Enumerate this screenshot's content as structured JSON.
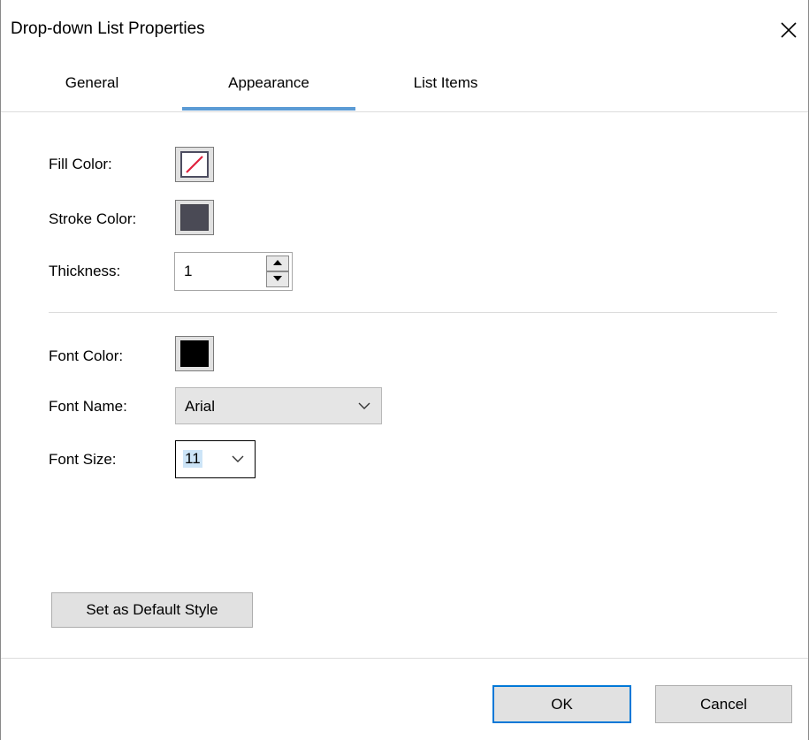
{
  "window": {
    "title": "Drop-down List Properties",
    "close_icon": "close-icon"
  },
  "tabs": [
    {
      "label": "General",
      "active": false
    },
    {
      "label": "Appearance",
      "active": true
    },
    {
      "label": "List Items",
      "active": false
    }
  ],
  "appearance": {
    "fill_color": {
      "label": "Fill Color:",
      "value": "none"
    },
    "stroke_color": {
      "label": "Stroke Color:",
      "value": "#4a4a55"
    },
    "thickness": {
      "label": "Thickness:",
      "value": "1"
    },
    "font_color": {
      "label": "Font Color:",
      "value": "#000000"
    },
    "font_name": {
      "label": "Font Name:",
      "value": "Arial"
    },
    "font_size": {
      "label": "Font Size:",
      "value": "11"
    }
  },
  "buttons": {
    "set_default": "Set as Default Style",
    "ok": "OK",
    "cancel": "Cancel"
  },
  "colors": {
    "accent": "#5b9bd5",
    "focus": "#0078d7",
    "no_fill_slash": "#e0203c"
  }
}
